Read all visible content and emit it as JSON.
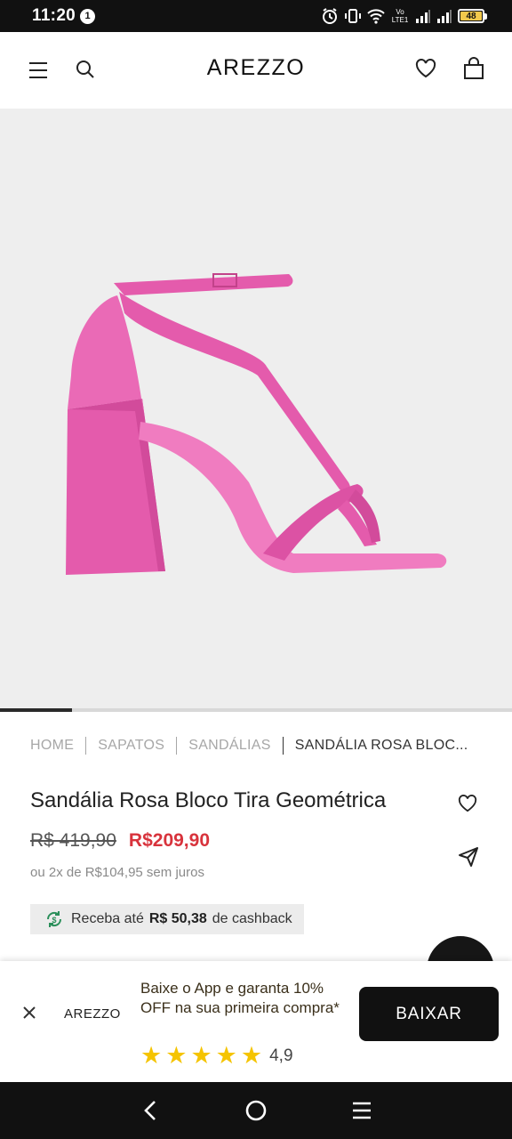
{
  "status_bar": {
    "time": "11:20",
    "notification_count": "1",
    "network_label": "Vo LTE1",
    "battery_level": "48"
  },
  "header": {
    "brand": "AREZZO",
    "icons": [
      "menu-icon",
      "search-icon",
      "heart-icon",
      "bag-icon"
    ]
  },
  "gallery": {
    "image_subject": "pink block-heel sandal",
    "progress": 0.14,
    "colors": {
      "background": "#eeeeee",
      "product": "#e45bac",
      "track": "#d8d8d8",
      "fill": "#2a2a2a"
    }
  },
  "breadcrumb": {
    "items": [
      "HOME",
      "SAPATOS",
      "SANDÁLIAS",
      "SANDÁLIA ROSA BLOC..."
    ]
  },
  "product": {
    "title": "Sandália Rosa Bloco Tira Geométrica",
    "price_old": "R$ 419,90",
    "price_new": "R$209,90",
    "installments": "ou 2x de R$104,95 sem juros",
    "cashback_prefix": "Receba até",
    "cashback_value": "R$ 50,38",
    "cashback_suffix": "de cashback",
    "price_color": "#d8333c"
  },
  "app_banner": {
    "logo": "AREZZO",
    "text": "Baixe o App e garanta 10% OFF na sua primeira compra*",
    "stars": 5,
    "rating": "4,9",
    "button": "BAIXAR"
  },
  "nav_bar": {
    "icons": [
      "back-icon",
      "home-icon",
      "recents-icon"
    ]
  }
}
